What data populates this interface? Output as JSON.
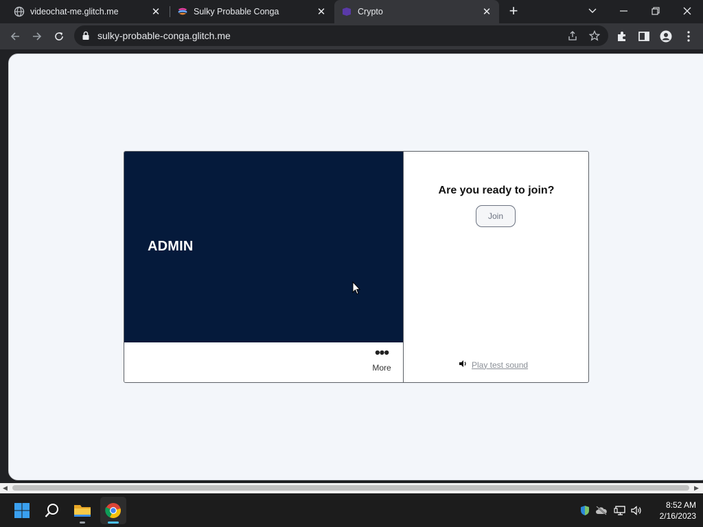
{
  "browser": {
    "tabs": [
      {
        "title": "videochat-me.glitch.me",
        "icon": "globe-icon",
        "active": false
      },
      {
        "title": "Sulky Probable Conga",
        "icon": "glitch-fish-icon",
        "active": false
      },
      {
        "title": "Crypto",
        "icon": "crypto-favicon-icon",
        "active": true
      }
    ],
    "url": "sulky-probable-conga.glitch.me"
  },
  "page": {
    "username": "ADMIN",
    "more_label": "More",
    "prompt": "Are you ready to join?",
    "join_label": "Join",
    "test_sound_label": "Play test sound"
  },
  "taskbar": {
    "time": "8:52 AM",
    "date": "2/16/2023"
  },
  "colors": {
    "video_bg": "#051a3b",
    "page_bg": "#f3f6fa",
    "chrome_dark": "#202124",
    "chrome_toolbar": "#35363a"
  }
}
